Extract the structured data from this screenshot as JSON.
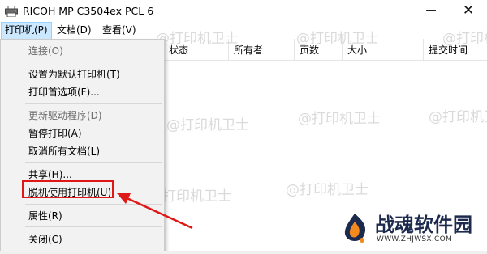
{
  "window": {
    "title": "RICOH MP C3504ex PCL 6",
    "minimize_glyph": "—",
    "close_glyph": "✕"
  },
  "menubar": {
    "items": [
      {
        "label": "打印机(P)",
        "active": true
      },
      {
        "label": "文档(D)"
      },
      {
        "label": "查看(V)"
      }
    ]
  },
  "columns": [
    "状态",
    "所有者",
    "页数",
    "大小",
    "提交时间"
  ],
  "printer_menu": {
    "items": [
      {
        "label": "连接(O)",
        "disabled": true
      },
      {
        "label": "设置为默认打印机(T)"
      },
      {
        "label": "打印首选项(F)..."
      },
      {
        "label": "更新驱动程序(D)",
        "disabled": true
      },
      {
        "label": "暂停打印(A)"
      },
      {
        "label": "取消所有文档(L)"
      },
      {
        "label": "共享(H)..."
      },
      {
        "label": "脱机使用打印机(U)",
        "highlighted": true
      },
      {
        "label": "属性(R)"
      },
      {
        "label": "关闭(C)"
      }
    ]
  },
  "watermark": "@打印机卫士",
  "logo": {
    "title": "战魂软件园",
    "url": "WWW.ZHJWSX.COM"
  },
  "colors": {
    "highlight_red": "#e01717",
    "menu_active_bg": "#cce8ff",
    "logo_navy": "#1c2a4d",
    "logo_orange": "#f28a1e"
  }
}
